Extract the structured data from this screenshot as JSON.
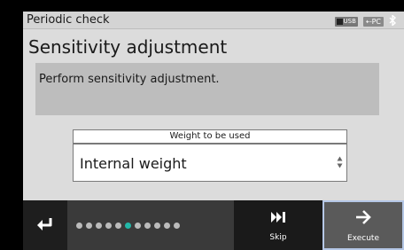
{
  "status_bar": {
    "title": "Periodic check",
    "usb_label": "USB",
    "pc_label": "PC",
    "bluetooth_icon": "bluetooth-icon"
  },
  "main": {
    "title": "Sensitivity adjustment",
    "message": "Perform sensitivity adjustment."
  },
  "weight": {
    "label": "Weight to be used",
    "value": "Internal weight"
  },
  "bottom_bar": {
    "back_icon": "return-arrow-icon",
    "step_indicator": {
      "total": 11,
      "current": 6
    },
    "skip_label": "Skip",
    "execute_label": "Execute"
  },
  "colors": {
    "active_dot": "#22b8a8",
    "panel_bg": "#dcdcdc",
    "bottom_bar_bg": "#3a3a3a"
  }
}
